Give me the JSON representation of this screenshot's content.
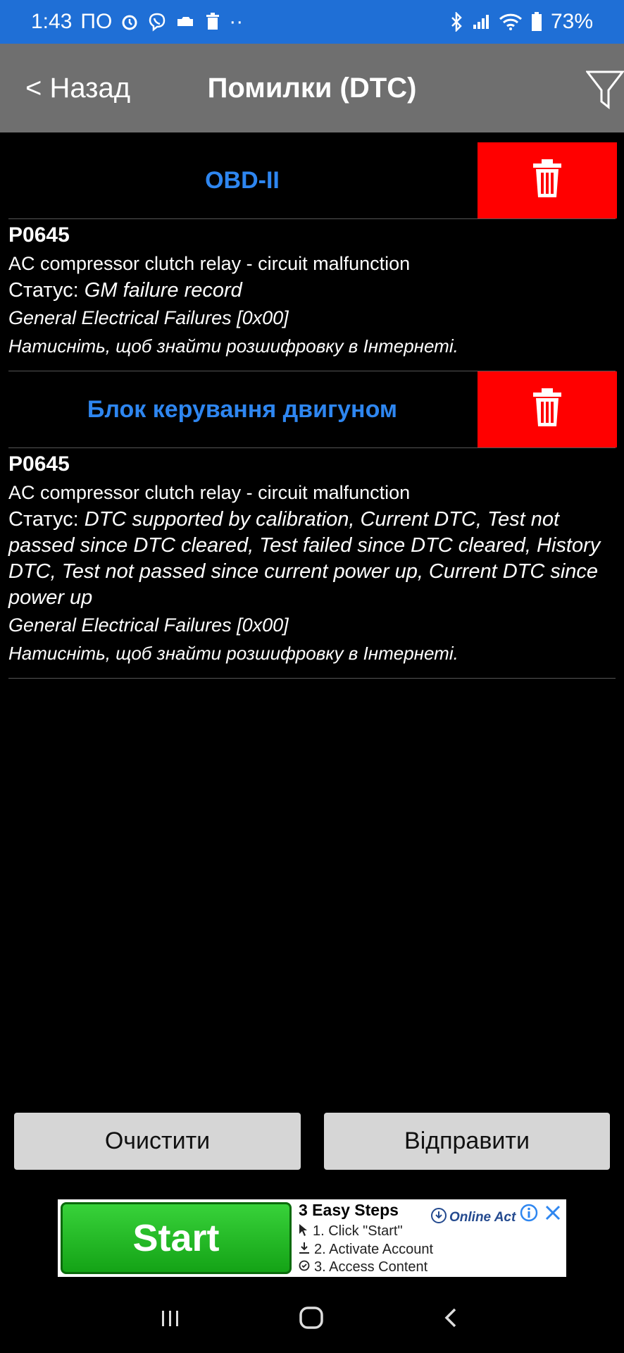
{
  "status_bar": {
    "time": "1:43",
    "carrier": "ПО",
    "dots": "··",
    "battery": "73%"
  },
  "header": {
    "back_label": "< Назад",
    "title": "Помилки (DTC)"
  },
  "modules": [
    {
      "title": "OBD-II",
      "dtc": {
        "code": "P0645",
        "description": "AC compressor clutch relay - circuit malfunction",
        "status_label": "Статус: ",
        "status_value": "GM failure record",
        "category": "General Electrical Failures [0x00]",
        "hint": "Натисніть, щоб знайти розшифровку в Інтернеті."
      }
    },
    {
      "title": "Блок керування двигуном",
      "dtc": {
        "code": "P0645",
        "description": "AC compressor clutch relay - circuit malfunction",
        "status_label": "Статус: ",
        "status_value": "DTC supported by calibration, Current DTC, Test not passed since DTC cleared, Test failed since DTC cleared, History DTC, Test not passed since current power up, Current DTC since power up",
        "category": "General Electrical Failures [0x00]",
        "hint": "Натисніть, щоб знайти розшифровку в Інтернеті."
      }
    }
  ],
  "buttons": {
    "clear": "Очистити",
    "send": "Відправити"
  },
  "ad": {
    "cta": "Start",
    "steps_title": "3 Easy Steps",
    "steps": [
      "1. Click \"Start\"",
      "2. Activate Account",
      "3. Access Content"
    ],
    "brand": "Online Act"
  },
  "colors": {
    "status_bar": "#1f6fd6",
    "header": "#6f6f6f",
    "module_title": "#2e86f0",
    "delete": "#ff0000",
    "button": "#d6d6d6"
  }
}
